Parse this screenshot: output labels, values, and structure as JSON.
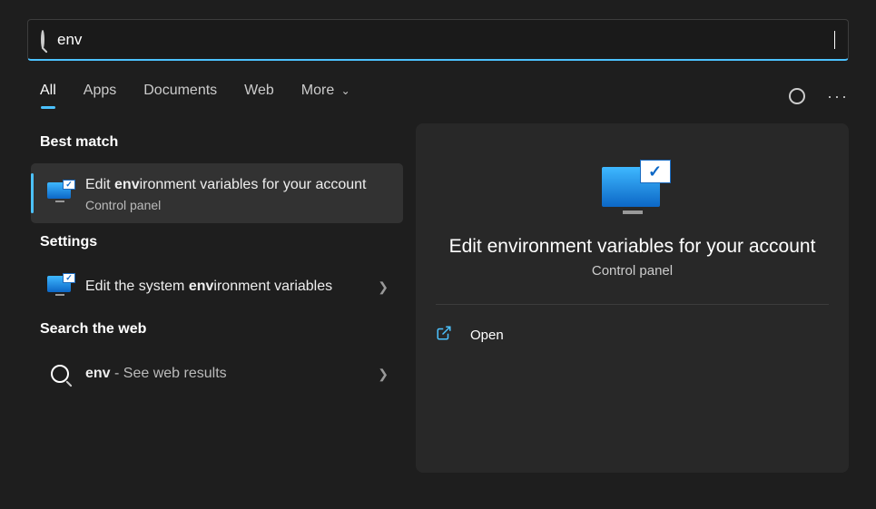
{
  "search": {
    "query": "env"
  },
  "tabs": [
    "All",
    "Apps",
    "Documents",
    "Web",
    "More"
  ],
  "activeTab": 0,
  "sections": {
    "bestMatch": {
      "label": "Best match",
      "item": {
        "title_pre": "Edit ",
        "title_bold": "env",
        "title_post": "ironment variables for your account",
        "subtitle": "Control panel"
      }
    },
    "settings": {
      "label": "Settings",
      "item": {
        "title_pre": "Edit the system ",
        "title_bold": "env",
        "title_post": "ironment variables"
      }
    },
    "web": {
      "label": "Search the web",
      "item": {
        "title_bold": "env",
        "title_post": " - See web results"
      }
    }
  },
  "preview": {
    "title": "Edit environment variables for your account",
    "subtitle": "Control panel",
    "action": "Open"
  }
}
